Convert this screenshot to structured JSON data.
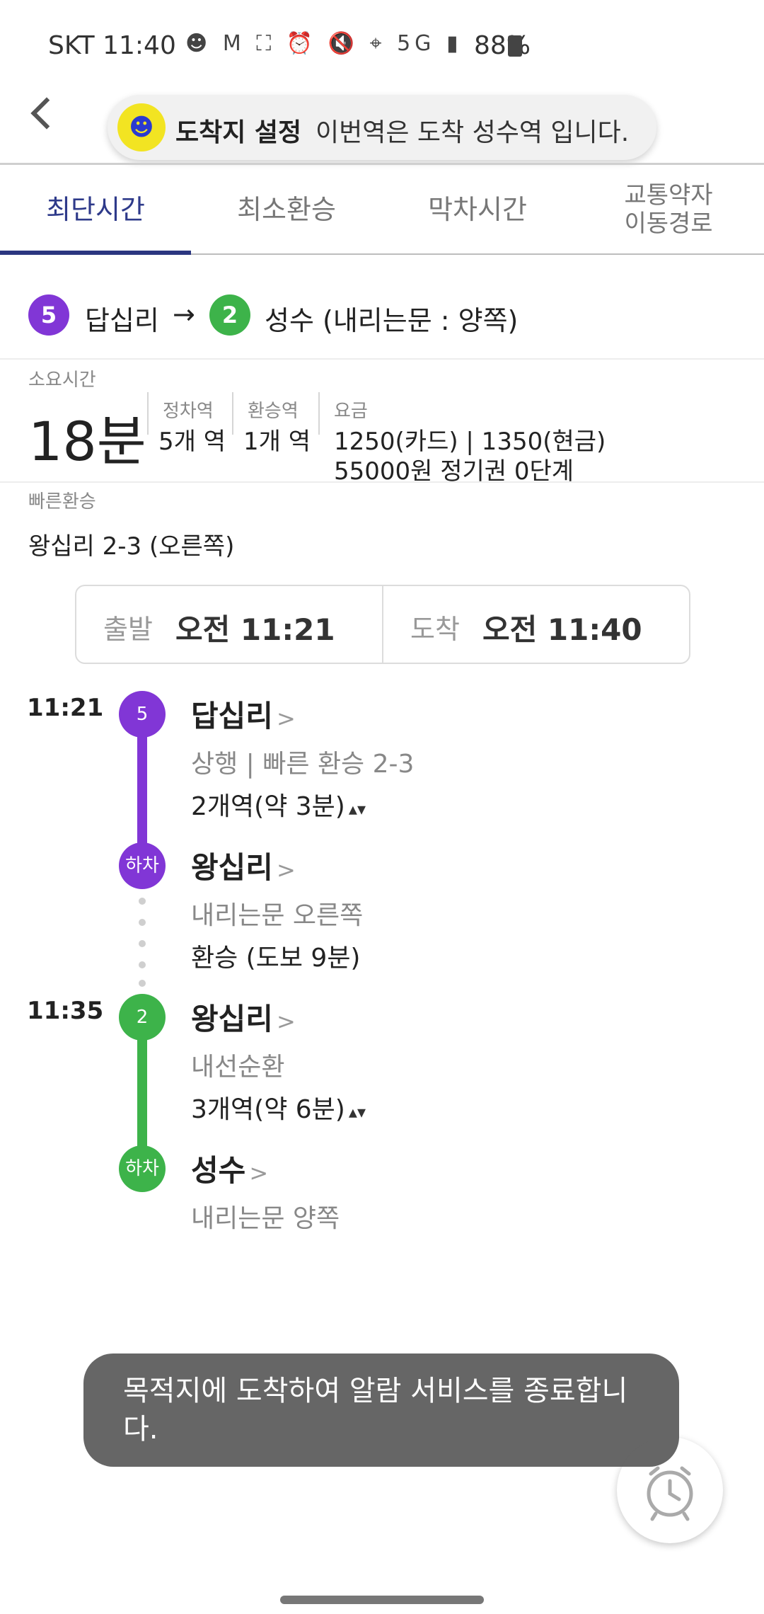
{
  "status": {
    "carrier_time": "SKT 11:40",
    "battery": "88%",
    "icons": [
      "character-icon",
      "gmail-icon",
      "screenshot-icon",
      "alarm-icon",
      "mute-icon",
      "location-icon",
      "5g-icon",
      "signal-icon",
      "battery-icon"
    ]
  },
  "header": {
    "destination_label": "도착지 설정",
    "destination_msg": "이번역은 도착 성수역 입니다."
  },
  "tabs": [
    {
      "label": "최단시간"
    },
    {
      "label": "최소환승"
    },
    {
      "label": "막차시간"
    },
    {
      "label": "교통약자\n이동경로"
    }
  ],
  "route": {
    "from_line": "5",
    "from_station": "답십리",
    "arrow": "→",
    "to_line": "2",
    "to_station": "성수 (내리는문 : 양쪽)"
  },
  "summary": {
    "duration_label": "소요시간",
    "duration": "18분",
    "stops_label": "정차역",
    "stops": "5개 역",
    "transfers_label": "환승역",
    "transfers": "1개 역",
    "fare_label": "요금",
    "fare": "1250(카드) | 1350(현금)",
    "pass": "55000원 정기권 0단계"
  },
  "fast_transfer": {
    "label": "빠른환승",
    "value": "왕십리 2-3 (오른쪽)"
  },
  "times": {
    "depart_label": "출발",
    "depart": "오전 11:21",
    "arrive_label": "도착",
    "arrive": "오전 11:40"
  },
  "timeline": {
    "seg1": {
      "time": "11:21",
      "line": "5",
      "station": "답십리",
      "direction": "상행 | 빠른 환승 2-3",
      "count": "2개역(약 3분)"
    },
    "alight1": {
      "badge": "하차",
      "station": "왕십리",
      "door": "내리는문 오른쪽",
      "walk": "환승 (도보 9분)"
    },
    "seg2": {
      "time": "11:35",
      "line": "2",
      "station": "왕십리",
      "direction": "내선순환",
      "count": "3개역(약 6분)"
    },
    "alight2": {
      "badge": "하차",
      "station": "성수",
      "door": "내리는문 양쪽"
    }
  },
  "toast": {
    "message": "목적지에 도착하여 알람 서비스를 종료합니다."
  },
  "colors": {
    "line5": "#8136d6",
    "line2": "#3db34a",
    "tab_active": "#2b3680",
    "pill_icon_bg": "#f2e422"
  }
}
